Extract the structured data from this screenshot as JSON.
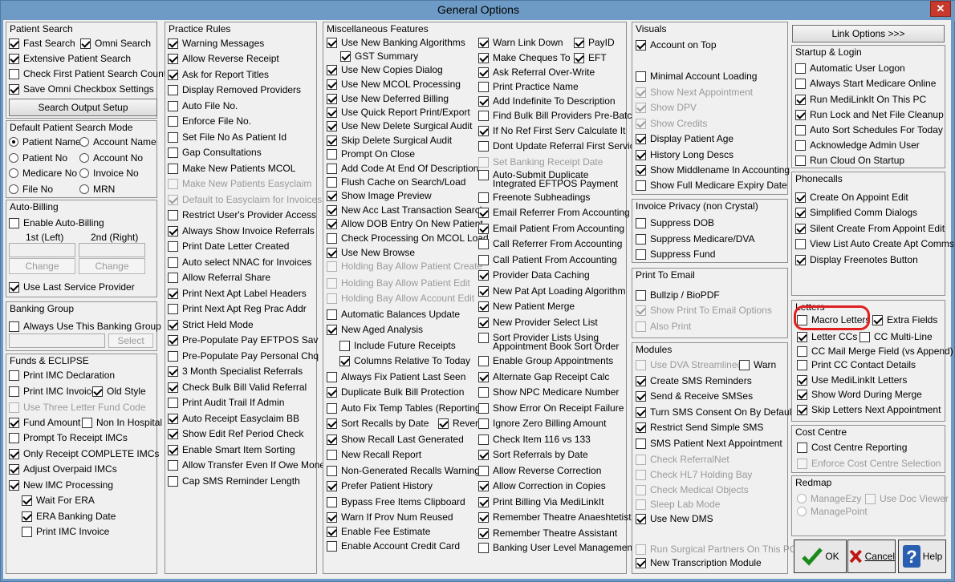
{
  "window": {
    "title": "General Options",
    "close_label": "✕"
  },
  "patient_search": {
    "title": "Patient Search",
    "fast_search": "Fast Search",
    "omni_search": "Omni Search",
    "extensive": "Extensive Patient Search",
    "check_first": "Check First Patient Search Count",
    "save_omni": "Save Omni Checkbox Settings",
    "output_btn": "Search Output Setup"
  },
  "default_mode": {
    "title": "Default Patient Search Mode",
    "patient_name": "Patient Name",
    "account_name": "Account Name",
    "patient_no": "Patient No",
    "account_no": "Account No",
    "medicare_no": "Medicare No",
    "invoice_no": "Invoice No",
    "file_no": "File No",
    "mrn": "MRN"
  },
  "auto_billing": {
    "title": "Auto-Billing",
    "enable": "Enable Auto-Billing",
    "first": "1st (Left)",
    "second": "2nd (Right)",
    "change1": "Change",
    "change2": "Change",
    "last_provider": "Use Last Service Provider"
  },
  "banking_group": {
    "title": "Banking Group",
    "always": "Always Use This Banking Group",
    "select": "Select"
  },
  "funds": {
    "title": "Funds & ECLIPSE",
    "items": [
      "Print IMC Declaration",
      "Print IMC Invoice",
      "Old Style",
      "Use Three Letter Fund Code",
      "Fund Amount",
      "Non In Hospital",
      "Prompt To Receipt IMCs",
      "Only Receipt COMPLETE IMCs",
      "Adjust Overpaid IMCs",
      "New IMC Processing",
      "Wait For ERA",
      "ERA Banking Date",
      "Print IMC Invoice"
    ]
  },
  "practice_rules": {
    "title": "Practice Rules",
    "items": [
      "Warning Messages",
      "Allow Reverse Receipt",
      "Ask for Report Titles",
      "Display Removed Providers",
      "Auto File No.",
      "Enforce File No.",
      "Set File No As Patient Id",
      "Gap Consultations",
      "Make New Patients MCOL",
      "Make New Patients Easyclaim",
      "Default to Easyclaim for Invoices",
      "Restrict User's Provider Access",
      "Always Show Invoice Referrals",
      "Print Date Letter Created",
      "Auto select NNAC for Invoices",
      "Allow Referral Share",
      "Print Next Apt Label Headers",
      "Print Next Apt Reg Prac Addr",
      "Strict Held Mode",
      "Pre-Populate Pay EFTPOS Sav",
      "Pre-Populate Pay Personal Chq",
      "3 Month Specialist Referrals",
      "Check Bulk Bill Valid Referral",
      "Print Audit Trail If Admin",
      "Auto Receipt Easyclaim BB",
      "Show Edit Ref Period Check",
      "Enable Smart Item Sorting",
      "Allow Transfer Even If Owe Money",
      "Cap SMS Reminder Length"
    ]
  },
  "misc": {
    "title": "Miscellaneous Features",
    "col1": [
      "Use New Banking Algorithms",
      "GST Summary",
      "Use New Copies Dialog",
      "Use New MCOL Processing",
      "Use New Deferred Billing",
      "Use Quick Report Print/Export",
      "Use New Delete Surgical Audit",
      "Skip Delete Surgical Audit",
      "Prompt On Close",
      "Add Code At End Of Description",
      "Flush Cache on Search/Load",
      "Show Image Preview",
      "New Acc Last Transaction Search",
      "Allow DOB Entry On New Patient",
      "Check Processing On MCOL Load",
      "Use New Browse",
      "Holding Bay Allow Patient Create",
      "Holding Bay Allow Patient Edit",
      "Holding Bay Allow Account Edit",
      "Automatic Balances Update",
      "New Aged Analysis",
      "Include Future Receipts",
      "Columns Relative To Today",
      "Always Fix Patient Last Seen",
      "Duplicate Bulk Bill Protection",
      "Auto Fix Temp Tables (Reporting)",
      "Sort Recalls by Date",
      "Reverse",
      "Show Recall Last Generated",
      "New Recall Report",
      "Non-Generated Recalls Warning",
      "Prefer Patient History",
      "Bypass Free Items Clipboard",
      "Warn If Prov Num Reused",
      "Enable Fee Estimate",
      "Enable Account Credit Card"
    ],
    "col2": [
      "Warn Link Down",
      "PayID",
      "Make Cheques To",
      "EFT",
      "Ask Referral Over-Write",
      "Print Practice Name",
      "Add Indefinite To Description",
      "Find Bulk Bill Providers Pre-Batch",
      "If No Ref First Serv Calculate It",
      "Dont Update Referral First Service",
      "Set Banking Receipt Date",
      "Auto-Submit Duplicate",
      "Integrated EFTPOS Payment",
      "Freenote Subheadings",
      "Email Referrer From Accounting",
      "Email Patient From Accounting",
      "Call Referrer From Accounting",
      "Call Patient From Accounting",
      "Provider Data Caching",
      "New Pat Apt Loading Algorithm",
      "New Patient Merge",
      "New Provider Select List",
      "Sort Provider Lists Using",
      "Appointment Book Sort Order",
      "Enable Group Appointments",
      "Alternate Gap Receipt Calc",
      "Show NPC Medicare Number",
      "Show Error On Receipt Failure",
      "Ignore Zero Billing Amount",
      "Check Item 116 vs 133",
      "Sort Referrals by Date",
      "Allow Reverse Correction",
      "Allow Correction in Copies",
      "Print Billing Via MediLinkIt",
      "Remember Theatre Anaeshtetist",
      "Remember Theatre Assistant",
      "Banking User Level Management"
    ]
  },
  "visuals": {
    "title": "Visuals",
    "items": [
      "Account on Top",
      "Minimal Account Loading",
      "Show Next Appointment",
      "Show DPV",
      "Show Credits",
      "Display Patient Age",
      "History Long Descs",
      "Show Middlename In Accounting",
      "Show Full Medicare Expiry Date"
    ]
  },
  "invoice_privacy": {
    "title": "Invoice Privacy (non Crystal)",
    "items": [
      "Suppress DOB",
      "Suppress Medicare/DVA",
      "Suppress Fund"
    ]
  },
  "print_email": {
    "title": "Print To Email",
    "items": [
      "Bullzip / BioPDF",
      "Show Print To Email Options",
      "Also Print"
    ]
  },
  "modules": {
    "title": "Modules",
    "items": [
      "Use DVA Streamlined",
      "Warn",
      "Create SMS Reminders",
      "Send & Receive SMSes",
      "Turn SMS Consent On By Default",
      "Restrict Send Simple SMS",
      "SMS Patient Next Appointment",
      "Check ReferralNet",
      "Check HL7 Holding Bay",
      "Check Medical Objects",
      "Sleep Lab Mode",
      "Use New DMS",
      "Run Surgical Partners On This PC",
      "New Transcription Module"
    ]
  },
  "link_options": "Link Options >>>",
  "startup": {
    "title": "Startup & Login",
    "items": [
      "Automatic User Logon",
      "Always Start Medicare Online",
      "Run MediLinkIt On This PC",
      "Run Lock and Net File Cleanup",
      "Auto Sort Schedules For Today",
      "Acknowledge Admin User",
      "Run Cloud On Startup"
    ]
  },
  "phonecalls": {
    "title": "Phonecalls",
    "items": [
      "Create On Appoint Edit",
      "Simplified Comm Dialogs",
      "Silent Create From Appoint Edit",
      "View List Auto Create Apt Comms",
      "Display Freenotes Button"
    ]
  },
  "letters": {
    "title": "Letters",
    "items": [
      "Macro Letters",
      "Extra Fields",
      "Letter CCs",
      "CC Multi-Line",
      "CC Mail Merge Field (vs Append)",
      "Print CC Contact Details",
      "Use MediLinkIt Letters",
      "Show Word During Merge",
      "Skip Letters Next Appointment"
    ]
  },
  "cost_centre": {
    "title": "Cost Centre",
    "items": [
      "Cost Centre Reporting",
      "Enforce Cost Centre Selection"
    ]
  },
  "redmap": {
    "title": "Redmap",
    "items": [
      "ManageEzy",
      "Use Doc Viewer",
      "ManagePoint"
    ]
  },
  "buttons": {
    "ok": "OK",
    "cancel": "Cancel",
    "help": "Help"
  }
}
